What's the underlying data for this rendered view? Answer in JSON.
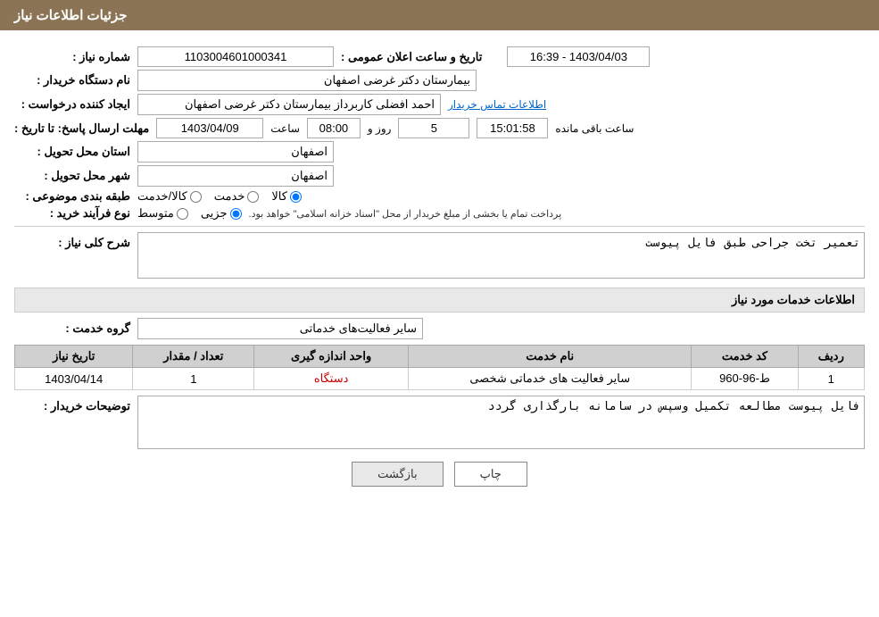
{
  "header": {
    "title": "جزئیات اطلاعات نیاز"
  },
  "fields": {
    "shomara_niaz_label": "شماره نیاز :",
    "shomara_niaz_value": "1103004601000341",
    "nam_dastgah_label": "نام دستگاه خریدار :",
    "nam_dastgah_value": "بیمارستان دکتر غرضی اصفهان",
    "tarikho_saat_label": "تاریخ و ساعت اعلان عمومی :",
    "tarikho_saat_value": "1403/04/03 - 16:39",
    "ijad_konande_label": "ایجاد کننده درخواست :",
    "ijad_konande_value": "احمد افضلی کاربرداز بیمارستان دکتر غرضی اصفهان",
    "ettelaat_tamas_link": "اطلاعات تماس خریدار",
    "mohlat_label": "مهلت ارسال پاسخ: تا تاریخ :",
    "mohlat_date": "1403/04/09",
    "mohlat_saat_label": "ساعت",
    "mohlat_saat": "08:00",
    "mohlat_roz_label": "روز و",
    "mohlat_roz": "5",
    "mohlat_remaining_label": "ساعت باقی مانده",
    "mohlat_remaining": "15:01:58",
    "ostan_label": "استان محل تحویل :",
    "ostan_value": "اصفهان",
    "shahr_label": "شهر محل تحویل :",
    "shahr_value": "اصفهان",
    "tabaqe_label": "طبقه بندی موضوعی :",
    "radio_kala": "کالا",
    "radio_khedmat": "خدمت",
    "radio_kala_khedmat": "کالا/خدمت",
    "nooe_farayand_label": "نوع فرآیند خرید :",
    "radio_jozei": "جزیی",
    "radio_motavasset": "متوسط",
    "farayand_description": "پرداخت تمام یا بخشی از مبلغ خریدار از محل \"اسناد خزانه اسلامی\" خواهد بود.",
    "sharh_label": "شرح کلی نیاز :",
    "sharh_value": "تعمیر تخت جراحی طبق فایل پیوست",
    "khadamat_label": "اطلاعات خدمات مورد نیاز",
    "goroh_label": "گروه خدمت :",
    "goroh_value": "سایر فعالیت‌های خدماتی",
    "table": {
      "headers": [
        "ردیف",
        "کد خدمت",
        "نام خدمت",
        "واحد اندازه گیری",
        "تعداد / مقدار",
        "تاریخ نیاز"
      ],
      "rows": [
        {
          "radif": "1",
          "kod": "ط-96-960",
          "nam": "سایر فعالیت های خدماتی شخصی",
          "vahed": "دستگاه",
          "tedad": "1",
          "tarikh": "1403/04/14"
        }
      ]
    },
    "toseef_label": "توضیحات خریدار :",
    "toseef_value": "فایل پیوست مطالعه تکمیل وسپس در سامانه بارگذاری گردد"
  },
  "buttons": {
    "print": "چاپ",
    "back": "بازگشت"
  }
}
